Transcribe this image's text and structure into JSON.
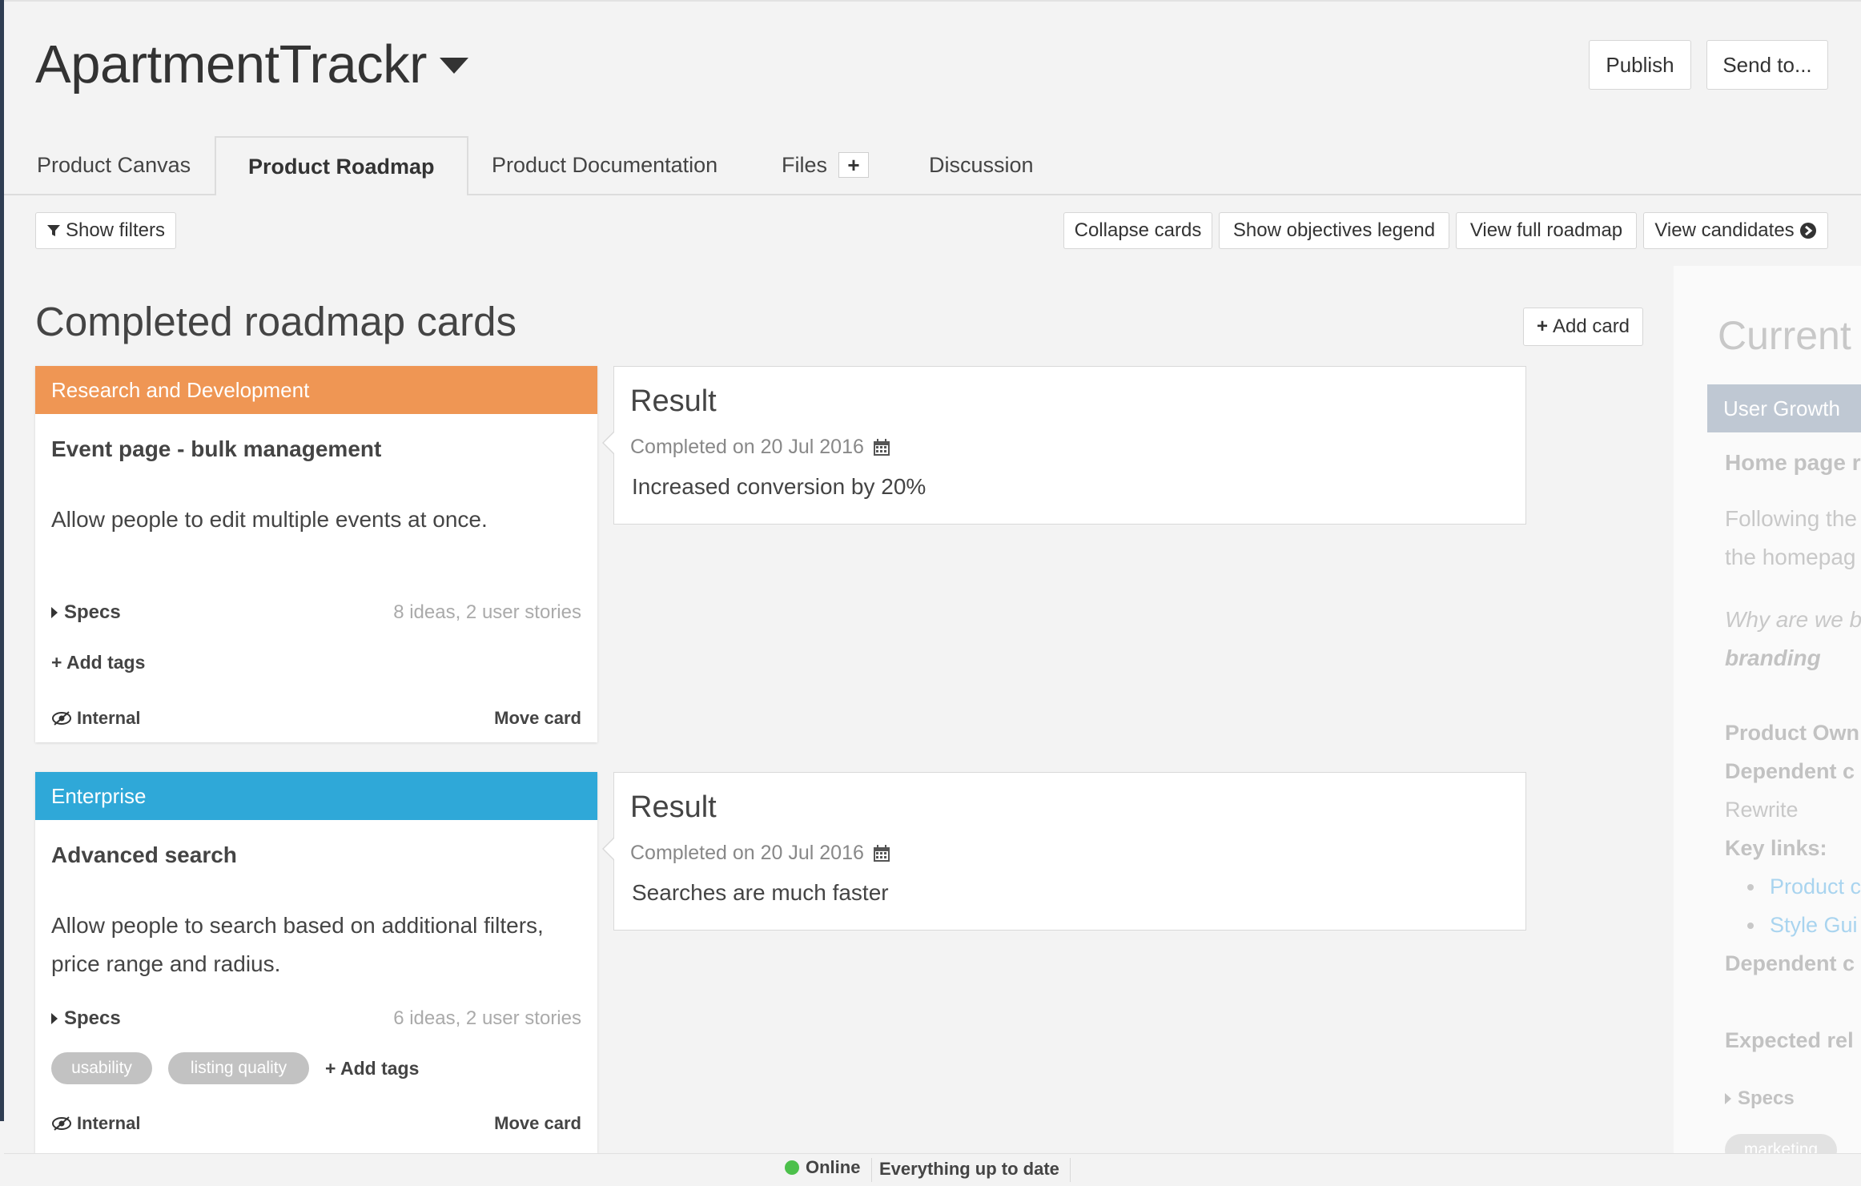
{
  "app": {
    "title": "ApartmentTrackr"
  },
  "header": {
    "publish_label": "Publish",
    "send_label": "Send to..."
  },
  "tabs": [
    {
      "label": "Product Canvas"
    },
    {
      "label": "Product Roadmap"
    },
    {
      "label": "Product Documentation"
    },
    {
      "label": "Files"
    },
    {
      "label": "Discussion"
    }
  ],
  "toolbar": {
    "show_filters": "Show filters",
    "collapse_cards": "Collapse cards",
    "show_objectives_legend": "Show objectives legend",
    "view_full_roadmap": "View full roadmap",
    "view_candidates": "View candidates"
  },
  "section": {
    "title": "Completed roadmap cards",
    "add_card": "Add card"
  },
  "cards": [
    {
      "category": "Research and Development",
      "category_color": "#ef9654",
      "title": "Event page - bulk management",
      "description": "Allow people to edit multiple events at once.",
      "specs_label": "Specs",
      "specs_count": "8 ideas, 2 user stories",
      "tags": [],
      "add_tags": "Add tags",
      "visibility": "Internal",
      "move": "Move card",
      "result": {
        "title": "Result",
        "completed": "Completed on 20 Jul 2016",
        "text": "Increased conversion by 20%"
      }
    },
    {
      "category": "Enterprise",
      "category_color": "#2fa8d8",
      "title": "Advanced search",
      "description": "Allow people to search based on additional filters, price range and radius.",
      "specs_label": "Specs",
      "specs_count": "6 ideas, 2 user stories",
      "tags": [
        "usability",
        "listing quality"
      ],
      "add_tags": "Add tags",
      "visibility": "Internal",
      "move": "Move card",
      "result": {
        "title": "Result",
        "completed": "Completed on 20 Jul 2016",
        "text": "Searches are much faster"
      }
    }
  ],
  "right_panel": {
    "title": "Current",
    "category": "User Growth",
    "card_title": "Home page r",
    "desc_line1": "Following the",
    "desc_line2": "the homepag",
    "why_line1": "Why are we b",
    "why_line2": "branding",
    "product_owner": "Product Own",
    "dependent_1": "Dependent c",
    "rewrite": "Rewrite",
    "key_links": "Key links:",
    "link_1": "Product c",
    "link_2": "Style Gui",
    "dependent_2": "Dependent c",
    "expected": "Expected rel",
    "specs": "Specs",
    "tag": "marketing"
  },
  "status": {
    "online": "Online",
    "message": "Everything up to date"
  }
}
